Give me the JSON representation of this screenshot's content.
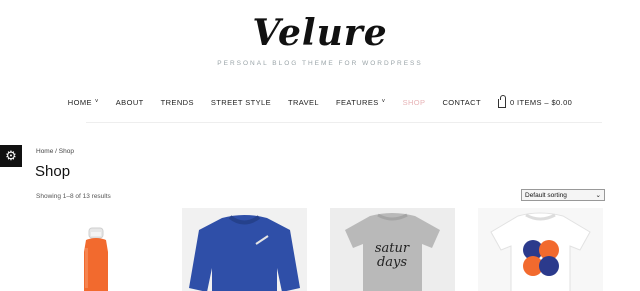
{
  "site": {
    "logo": "Velure",
    "tagline": "PERSONAL BLOG THEME FOR WORDPRESS"
  },
  "nav": {
    "items": [
      {
        "label": "HOME",
        "has_dropdown": true
      },
      {
        "label": "ABOUT"
      },
      {
        "label": "TRENDS"
      },
      {
        "label": "STREET STYLE"
      },
      {
        "label": "TRAVEL"
      },
      {
        "label": "FEATURES",
        "has_dropdown": true
      },
      {
        "label": "SHOP",
        "active": true
      },
      {
        "label": "CONTACT"
      }
    ],
    "cart": {
      "label": "0 ITEMS – $0.00",
      "icon": "shopping-bag-icon"
    },
    "active_color": "#e7b3b6"
  },
  "settings": {
    "icon": "gear-icon",
    "glyph": "⚙"
  },
  "breadcrumb": {
    "text": "Home / Shop"
  },
  "page": {
    "title": "Shop",
    "result_count": "Showing 1–8 of 13 results",
    "sorting": {
      "selected": "Default sorting",
      "chevron": "⌄"
    }
  },
  "products": [
    {
      "image": "orange-glass-water-bottle",
      "color": "#f26a2e"
    },
    {
      "image": "blue-sweatshirt",
      "color": "#2f4fa8"
    },
    {
      "image": "grey-t-shirt",
      "print": "satur\ndays",
      "color": "#b9b9b9"
    },
    {
      "image": "white-t-shirt",
      "color": "#ffffff"
    }
  ]
}
